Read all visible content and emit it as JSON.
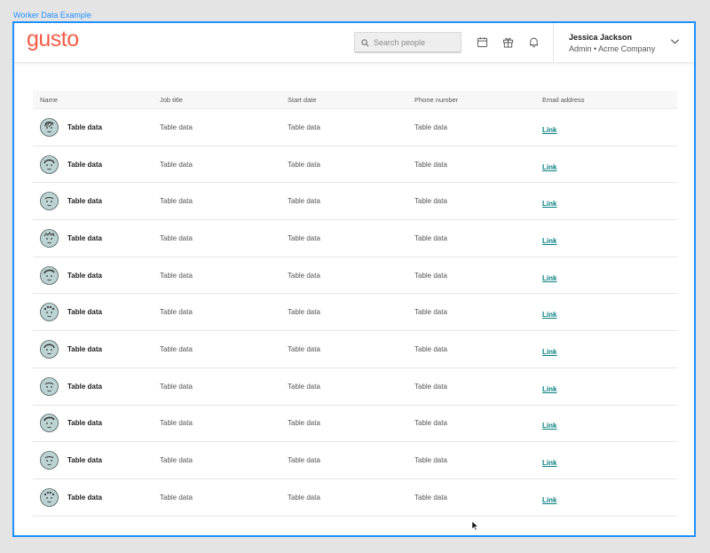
{
  "frame_label": "Worker Data Example",
  "header": {
    "logo": "gusto",
    "search_placeholder": "Search people",
    "user_name": "Jessica Jackson",
    "user_role": "Admin • Acme Company"
  },
  "table": {
    "columns": [
      "Name",
      "Job title",
      "Start date",
      "Phone number",
      "Email address"
    ],
    "rows": [
      {
        "name": "Table data",
        "job": "Table data",
        "start": "Table data",
        "phone": "Table data",
        "email": "Link"
      },
      {
        "name": "Table data",
        "job": "Table data",
        "start": "Table data",
        "phone": "Table data",
        "email": "Link"
      },
      {
        "name": "Table data",
        "job": "Table data",
        "start": "Table data",
        "phone": "Table data",
        "email": "Link"
      },
      {
        "name": "Table data",
        "job": "Table data",
        "start": "Table data",
        "phone": "Table data",
        "email": "Link"
      },
      {
        "name": "Table data",
        "job": "Table data",
        "start": "Table data",
        "phone": "Table data",
        "email": "Link"
      },
      {
        "name": "Table data",
        "job": "Table data",
        "start": "Table data",
        "phone": "Table data",
        "email": "Link"
      },
      {
        "name": "Table data",
        "job": "Table data",
        "start": "Table data",
        "phone": "Table data",
        "email": "Link"
      },
      {
        "name": "Table data",
        "job": "Table data",
        "start": "Table data",
        "phone": "Table data",
        "email": "Link"
      },
      {
        "name": "Table data",
        "job": "Table data",
        "start": "Table data",
        "phone": "Table data",
        "email": "Link"
      },
      {
        "name": "Table data",
        "job": "Table data",
        "start": "Table data",
        "phone": "Table data",
        "email": "Link"
      },
      {
        "name": "Table data",
        "job": "Table data",
        "start": "Table data",
        "phone": "Table data",
        "email": "Link"
      }
    ]
  },
  "icons": {
    "search": "search-icon",
    "calendar": "calendar-icon",
    "gift": "gift-icon",
    "bell": "bell-icon",
    "chevron": "chevron-down-icon",
    "avatar": "avatar-illustration-icon"
  },
  "colors": {
    "brand": "#f45d48",
    "link": "#0a8080",
    "frame_border": "#1e90ff",
    "avatar_bg": "#bcd3d3"
  }
}
